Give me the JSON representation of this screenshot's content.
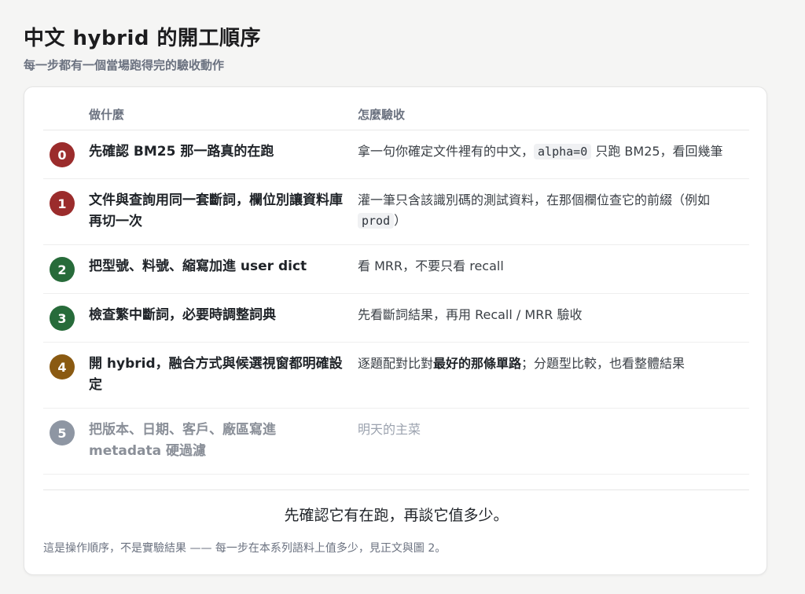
{
  "header": {
    "title": "中文 hybrid 的開工順序",
    "subtitle": "每一步都有一個當場跑得完的驗收動作"
  },
  "table": {
    "col_what": "做什麼",
    "col_check": "怎麼驗收",
    "rows": [
      {
        "num": "0",
        "color": "#9b2c2c",
        "what": "先確認 BM25 那一路真的在跑",
        "check_parts": [
          {
            "t": "text",
            "v": "拿一句你確定文件裡有的中文，"
          },
          {
            "t": "code",
            "v": "alpha=0"
          },
          {
            "t": "text",
            "v": " 只跑 BM25，看回幾筆"
          }
        ]
      },
      {
        "num": "1",
        "color": "#9b2c2c",
        "what": "文件與查詢用同一套斷詞，欄位別讓資料庫再切一次",
        "check_parts": [
          {
            "t": "text",
            "v": "灌一筆只含該識別碼的測試資料，在那個欄位查它的前綴（例如 "
          },
          {
            "t": "code",
            "v": "prod"
          },
          {
            "t": "text",
            "v": "）"
          }
        ]
      },
      {
        "num": "2",
        "color": "#276b3a",
        "what": "把型號、料號、縮寫加進 user dict",
        "check_parts": [
          {
            "t": "text",
            "v": "看 MRR，不要只看 recall"
          }
        ]
      },
      {
        "num": "3",
        "color": "#276b3a",
        "what": "檢查繁中斷詞，必要時調整詞典",
        "check_parts": [
          {
            "t": "text",
            "v": "先看斷詞結果，再用 Recall / MRR 驗收"
          }
        ]
      },
      {
        "num": "4",
        "color": "#8a5a12",
        "what": "開 hybrid，融合方式與候選視窗都明確設定",
        "check_parts": [
          {
            "t": "text",
            "v": "逐題配對比對"
          },
          {
            "t": "strong",
            "v": "最好的那條單路"
          },
          {
            "t": "text",
            "v": "；分題型比較，也看整體結果"
          }
        ]
      },
      {
        "num": "5",
        "color": "#8e96a3",
        "muted": true,
        "what": "把版本、日期、客戶、廠區寫進 metadata 硬過濾",
        "check_parts": [
          {
            "t": "text",
            "v": "明天的主菜"
          }
        ]
      }
    ]
  },
  "summary": "先確認它有在跑，再談它值多少。",
  "footnote": "這是操作順序，不是實驗結果 —— 每一步在本系列語料上值多少，見正文與圖 2。"
}
